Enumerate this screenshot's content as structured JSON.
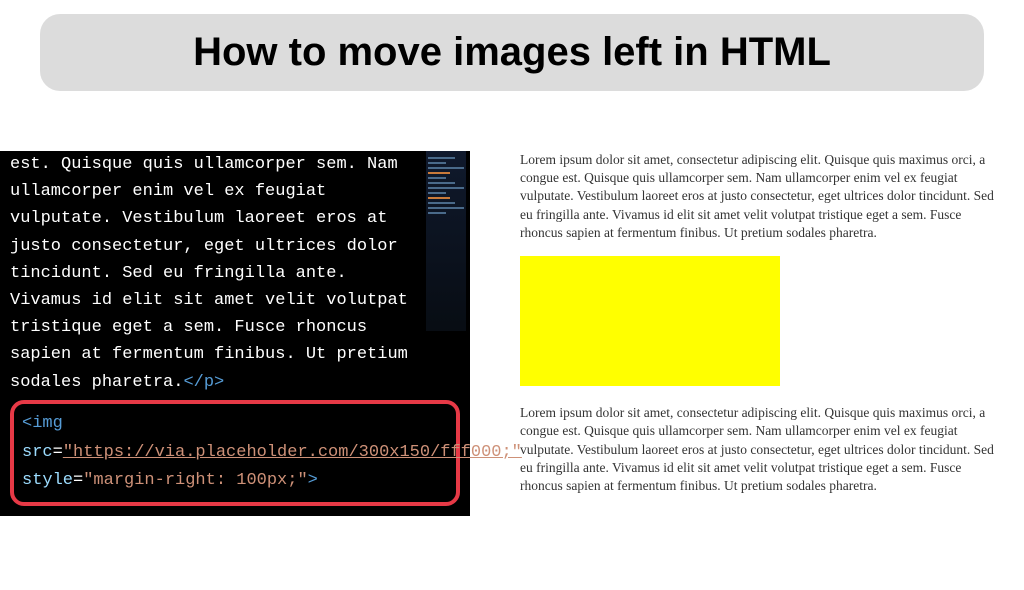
{
  "title": "How to move images left in HTML",
  "code": {
    "body_text": "est. Quisque quis ullamcorper sem. Nam ullamcorper enim vel ex feugiat vulputate. Vestibulum laoreet eros at justo consectetur, eget ultrices dolor tincidunt. Sed eu fringilla ante. Vivamus id elit sit amet velit volutpat tristique eget a sem. Fusce rhoncus sapien at fermentum finibus. Ut pretium sodales pharetra.",
    "closing_tag": "</p>",
    "img_tag_open": "<img",
    "src_attr": "src",
    "src_val": "\"https://via.placeholder.com/300x150/fff000;\"",
    "style_attr": "style",
    "style_val": "\"margin-right: 100px;\"",
    "tag_close": ">"
  },
  "preview": {
    "para1": "Lorem ipsum dolor sit amet, consectetur adipiscing elit. Quisque quis maximus orci, a congue est. Quisque quis ullamcorper sem. Nam ullamcorper enim vel ex feugiat vulputate. Vestibulum laoreet eros at justo consectetur, eget ultrices dolor tincidunt. Sed eu fringilla ante. Vivamus id elit sit amet velit volutpat tristique eget a sem. Fusce rhoncus sapien at fermentum finibus. Ut pretium sodales pharetra.",
    "para2": "Lorem ipsum dolor sit amet, consectetur adipiscing elit. Quisque quis maximus orci, a congue est. Quisque quis ullamcorper sem. Nam ullamcorper enim vel ex feugiat vulputate. Vestibulum laoreet eros at justo consectetur, eget ultrices dolor tincidunt. Sed eu fringilla ante. Vivamus id elit sit amet velit volutpat tristique eget a sem. Fusce rhoncus sapien at fermentum finibus. Ut pretium sodales pharetra."
  }
}
